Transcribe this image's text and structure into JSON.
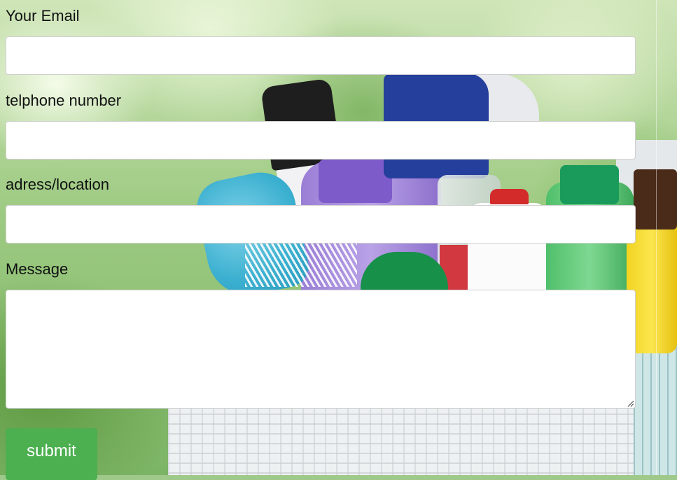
{
  "form": {
    "email": {
      "label": "Your Email",
      "value": "",
      "placeholder": ""
    },
    "phone": {
      "label": "telphone number",
      "value": "",
      "placeholder": ""
    },
    "address": {
      "label": "adress/location",
      "value": "",
      "placeholder": ""
    },
    "message": {
      "label": "Message",
      "value": "",
      "placeholder": ""
    },
    "submit_label": "submit"
  },
  "colors": {
    "submit_button": "#4caf50",
    "submit_text": "#ffffff",
    "label_text": "#111111",
    "input_border": "#cfcfcf"
  },
  "icons": {
    "textarea_resize": "resize-grip-icon"
  }
}
